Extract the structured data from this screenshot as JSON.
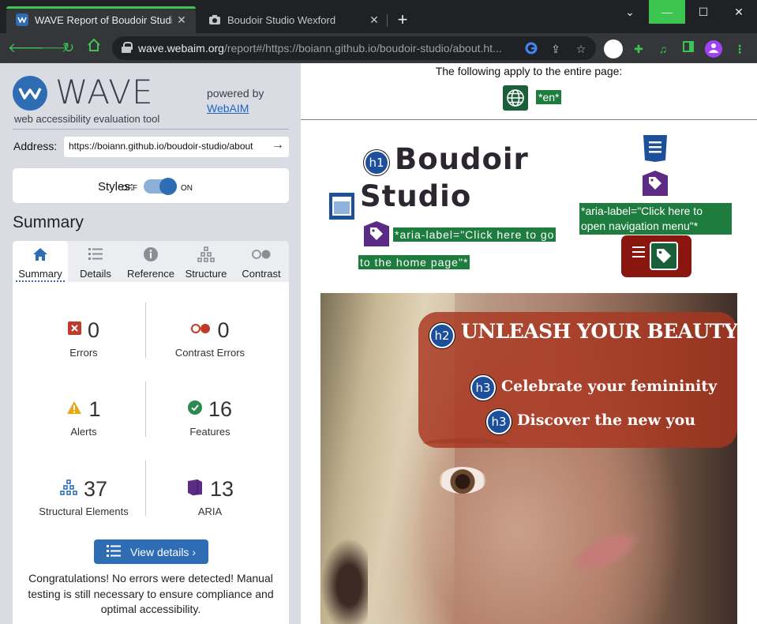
{
  "browser": {
    "tabs": [
      {
        "title": "WAVE Report of Boudoir Studio W",
        "active": true
      },
      {
        "title": "Boudoir Studio Wexford",
        "active": false
      }
    ],
    "url_host": "wave.webaim.org",
    "url_rest": "/report#/https://boiann.github.io/boudoir-studio/about.ht..."
  },
  "wave": {
    "logo_text": "WAVE",
    "tagline": "web accessibility evaluation tool",
    "powered_by": "powered by",
    "webaim_link": "WebAIM",
    "address_label": "Address:",
    "address_value": "https://boiann.github.io/boudoir-studio/about",
    "styles_label": "Styles:",
    "off_label": "OFF",
    "on_label": "ON",
    "summary_heading": "Summary",
    "tabs": [
      "Summary",
      "Details",
      "Reference",
      "Structure",
      "Contrast"
    ],
    "stats": {
      "errors": {
        "value": "0",
        "label": "Errors"
      },
      "contrast": {
        "value": "0",
        "label": "Contrast Errors"
      },
      "alerts": {
        "value": "1",
        "label": "Alerts"
      },
      "features": {
        "value": "16",
        "label": "Features"
      },
      "structural": {
        "value": "37",
        "label": "Structural Elements"
      },
      "aria": {
        "value": "13",
        "label": "ARIA"
      }
    },
    "view_details": "View details ›",
    "congrats": "Congratulations! No errors were detected! Manual testing is still necessary to ensure compliance and optimal accessibility."
  },
  "page": {
    "applies_text": "The following apply to the entire page:",
    "lang_tag": "*en*",
    "h1_badge": "h1",
    "brand_line1": "Boudoir",
    "brand_line2": "Studio",
    "aria_home_1": "*aria-label=\"Click here to go",
    "aria_home_2": "to the home page\"*",
    "aria_nav": "*aria-label=\"Click here to open navigation menu\"*",
    "h2_badge": "h2",
    "h2_text": "UNLEASH YOUR BEAUTY",
    "h3_badge": "h3",
    "h3_text_1": "Celebrate your femininity",
    "h3_text_2": "Discover the new you"
  },
  "colors": {
    "wave_blue": "#2e6db4",
    "error_red": "#c0392b",
    "alert_orange": "#e6a817",
    "feature_green": "#2d8a4e",
    "aria_purple": "#5b2b85",
    "menu_red": "#8a1610"
  }
}
